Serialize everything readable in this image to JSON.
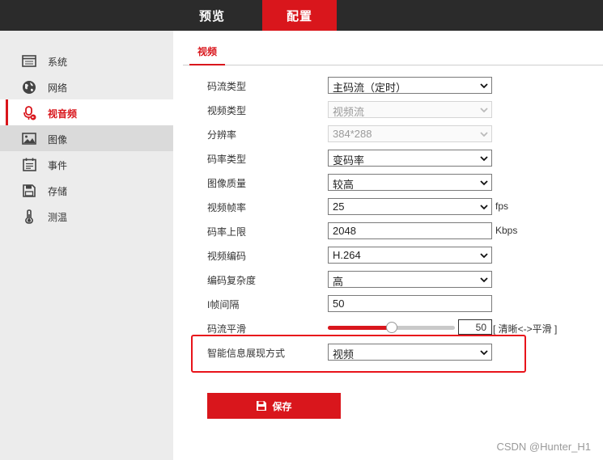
{
  "topnav": {
    "preview": "预览",
    "config": "配置"
  },
  "sidebar": {
    "items": [
      {
        "label": "系统",
        "icon": "system-window-icon"
      },
      {
        "label": "网络",
        "icon": "globe-icon"
      },
      {
        "label": "视音频",
        "icon": "microphone-icon",
        "active": true
      },
      {
        "label": "图像",
        "icon": "image-icon"
      },
      {
        "label": "事件",
        "icon": "calendar-icon"
      },
      {
        "label": "存储",
        "icon": "save-disk-icon"
      },
      {
        "label": "测温",
        "icon": "thermometer-icon"
      }
    ]
  },
  "tabs": {
    "video": "视频"
  },
  "form": {
    "stream_type": {
      "label": "码流类型",
      "value": "主码流（定时）"
    },
    "video_type": {
      "label": "视频类型",
      "value": "视频流"
    },
    "resolution": {
      "label": "分辨率",
      "value": "384*288"
    },
    "bitrate_type": {
      "label": "码率类型",
      "value": "变码率"
    },
    "image_quality": {
      "label": "图像质量",
      "value": "较高"
    },
    "frame_rate": {
      "label": "视频帧率",
      "value": "25",
      "unit": "fps"
    },
    "max_bitrate": {
      "label": "码率上限",
      "value": "2048",
      "unit": "Kbps"
    },
    "video_encoding": {
      "label": "视频编码",
      "value": "H.264"
    },
    "encoding_complexity": {
      "label": "编码复杂度",
      "value": "高"
    },
    "i_frame_interval": {
      "label": "I帧间隔",
      "value": "50"
    },
    "stream_smoothing": {
      "label": "码流平滑",
      "value": "50",
      "level": 0.5,
      "hint": "[ 清晰<->平滑 ]"
    },
    "smart_info_display": {
      "label": "智能信息展现方式",
      "value": "视频"
    }
  },
  "save_label": "保存",
  "watermark": "CSDN @Hunter_H1",
  "colors": {
    "accent": "#d9161c",
    "topbar": "#2b2b2b",
    "sidebar": "#ececec"
  }
}
